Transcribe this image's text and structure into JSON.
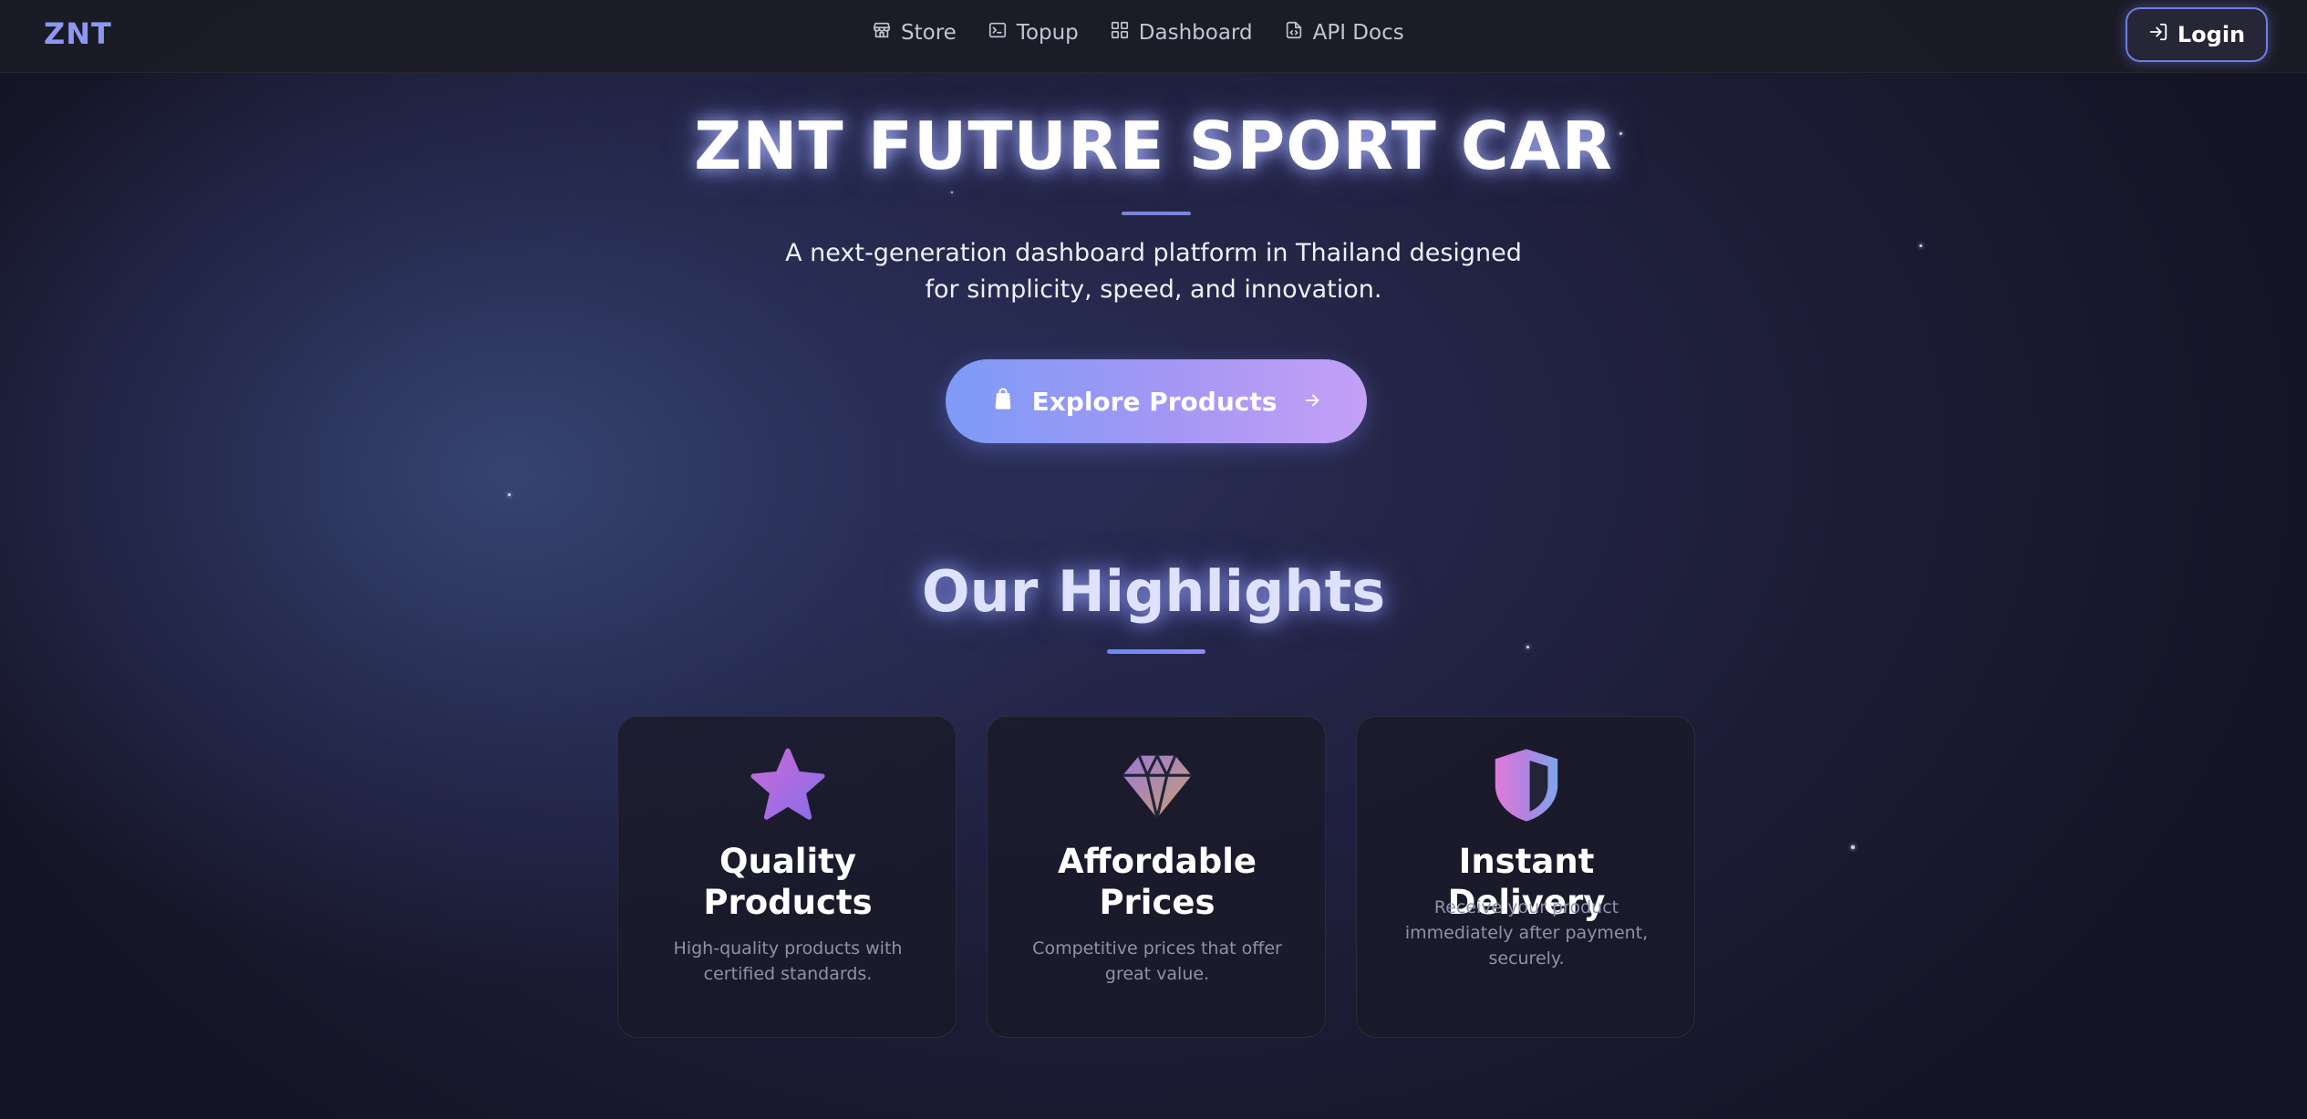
{
  "navbar": {
    "brand": "ZNT",
    "links": [
      {
        "label": "Store",
        "icon": "store-icon"
      },
      {
        "label": "Topup",
        "icon": "terminal-icon"
      },
      {
        "label": "Dashboard",
        "icon": "grid-icon"
      },
      {
        "label": "API Docs",
        "icon": "file-code-icon"
      }
    ],
    "login_label": "Login",
    "login_icon": "login-icon"
  },
  "hero": {
    "title": "ZNT FUTURE SPORT CAR",
    "subtitle_line1": "A next-generation dashboard platform in Thailand designed",
    "subtitle_line2": "for simplicity, speed, and innovation.",
    "cta_label": "Explore Products",
    "cta_icon": "shopping-bag-icon",
    "cta_arrow_icon": "arrow-right-icon"
  },
  "highlights": {
    "title": "Our Highlights",
    "cards": [
      {
        "icon": "star-icon",
        "title_line1": "Quality",
        "title_line2": "Products",
        "desc_line1": "High-quality products with",
        "desc_line2": "certified standards."
      },
      {
        "icon": "diamond-icon",
        "title_line1": "Affordable",
        "title_line2": "Prices",
        "desc_line1": "Competitive prices that offer",
        "desc_line2": "great value."
      },
      {
        "icon": "shield-icon",
        "title_line1": "Instant Delivery",
        "desc_line1": "Receive your product",
        "desc_line2": "immediately after payment,",
        "desc_line3": "securely."
      }
    ]
  },
  "colors": {
    "brand": "#8f97ee",
    "accent_start": "#7d9bf7",
    "accent_end": "#c5a0f6",
    "background": "#1c1c36"
  }
}
